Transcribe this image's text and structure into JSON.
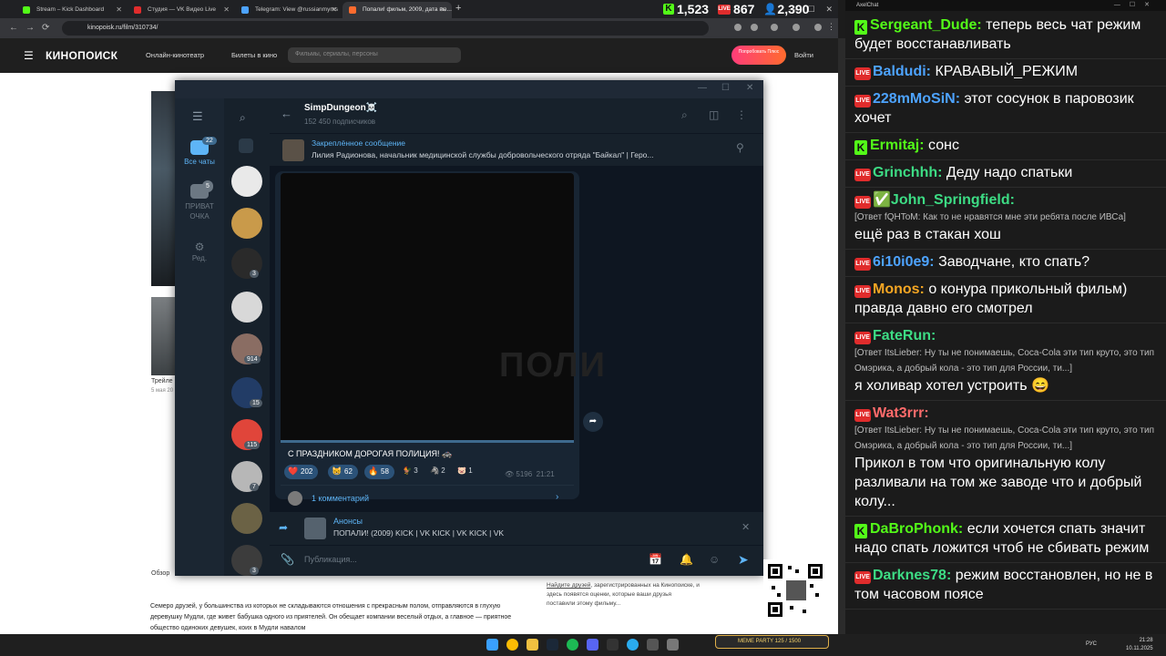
{
  "browser": {
    "tabs": [
      {
        "label": "Stream – Kick Dashboard",
        "color": "#53fc18"
      },
      {
        "label": "Студия — VK Видео Live",
        "color": "#e02c2c"
      },
      {
        "label": "Telegram: View @russianmyms",
        "color": "#4da3ff"
      },
      {
        "label": "Попали! фильм, 2009, дата вы...",
        "color": "#ff6b2e"
      }
    ],
    "new_tab": "+",
    "url": "kinopoisk.ru/film/310734/"
  },
  "stats": {
    "kick": "1,523",
    "vk": "867",
    "viewers": "2,390"
  },
  "kinopoisk": {
    "logo": "КИНОПОИСК",
    "nav": [
      "Онлайн-кинотеатр",
      "Билеты в кино"
    ],
    "search_placeholder": "Фильмы, сериалы, персоны",
    "promo": "Попробовать Плюс",
    "login": "Войти",
    "trailer": "Трейле",
    "date": "5 мая 20",
    "review": "Обзор",
    "description": "Семеро друзей, у большинства из которых не складываются отношения с прекрасным полом, отправляются в глухую деревушку Мудли, где живет бабушка одного из приятелей. Он обещает компании веселый отдых, а главное — приятное общество одиноких девушек, коих в Мудли навалом",
    "side_link": "Найдите друзей",
    "side_text": ", зарегистрированных на Кинопоиске, и здесь появятся оценки, которые ваши друзья поставили этому фильму..."
  },
  "telegram": {
    "folders": [
      {
        "label": "Все чаты",
        "badge": "22"
      },
      {
        "label": "ПРИВАТ ОЧКА",
        "badge": "5"
      },
      {
        "label": "Ред.",
        "badge": ""
      }
    ],
    "chat_badges": [
      "3",
      "914",
      "15",
      "115",
      "7",
      "3"
    ],
    "channel_name": "SimpDungeon☠️",
    "subscribers": "152 450 подписчиков",
    "pinned_title": "Закреплённое сообщение",
    "pinned_text": "Лилия Радионова, начальник медицинской службы добровольческого отряда \"Байкал\" | Геро...",
    "video_overlay": "ПОЛИ",
    "caption": "С ПРАЗДНИКОМ ДОРОГАЯ ПОЛИЦИЯ! 🚓",
    "reactions": [
      {
        "emoji": "❤️",
        "count": "202"
      },
      {
        "emoji": "😸",
        "count": "62"
      },
      {
        "emoji": "🔥",
        "count": "58"
      }
    ],
    "reactions_plain": [
      {
        "emoji": "🐓",
        "count": "3"
      },
      {
        "emoji": "🦓",
        "count": "2"
      },
      {
        "emoji": "🐷",
        "count": "1"
      }
    ],
    "views": "5196",
    "time": "21:21",
    "comments": "1 комментарий",
    "reply_title": "Анонсы",
    "reply_text": "ПОПАЛИ! (2009)  KICK | VK KICK | VK KICK | VK",
    "input_placeholder": "Публикация..."
  },
  "chat": {
    "title": "AxelChat",
    "messages": [
      {
        "platform": "kick",
        "name": "Sergeant_Dude:",
        "color": "#53fc18",
        "text": "теперь весь чат режим будет восстанавливать"
      },
      {
        "platform": "vk",
        "name": "Baldudi:",
        "color": "#4da3ff",
        "text": "КРАВАВЫЙ_РЕЖИМ"
      },
      {
        "platform": "vk",
        "name": "228mMoSiN:",
        "color": "#4da3ff",
        "text": "этот сосунок в паровозик хочет"
      },
      {
        "platform": "kick",
        "name": "Ermitaj:",
        "color": "#53fc18",
        "text": "сонс"
      },
      {
        "platform": "vk",
        "name": "Grinchhh:",
        "color": "#3ddc84",
        "text": "Деду надо спатьки"
      },
      {
        "platform": "vk",
        "name": "✅John_Springfield:",
        "color": "#3ddc84",
        "reply": "[Ответ fQHToM: Как то не нравятся мне эти ребята после ИВСа]",
        "text": "ещё раз в стакан хош"
      },
      {
        "platform": "vk",
        "name": "6i10i0e9:",
        "color": "#4da3ff",
        "text": "Заводчане, кто спать?"
      },
      {
        "platform": "vk",
        "name": "Monos:",
        "color": "#f5a623",
        "text": "о конура прикольный фильм) правда давно его смотрел"
      },
      {
        "platform": "vk",
        "name": "FateRun:",
        "color": "#3ddc84",
        "reply": "[Ответ ItsLieber: Ну ты не понимаешь, Coca-Cola эти тип круто, это тип Омэрика, а добрый кола - это тип для России, ти...]",
        "text": "я холивар хотел устроить 😄"
      },
      {
        "platform": "vk",
        "name": "Wat3rrr:",
        "color": "#ff6b6b",
        "reply": "[Ответ ItsLieber: Ну ты не понимаешь, Coca-Cola эти тип круто, это тип Омэрика, а добрый кола - это тип для России, ти...]",
        "text": "Прикол в том что оригинальную колу разливали на том же заводе что и добрый колу..."
      },
      {
        "platform": "kick",
        "name": "DaBroPhonk:",
        "color": "#53fc18",
        "text": "если хочется спать значит надо спать ложится чтоб не сбивать режим"
      },
      {
        "platform": "vk",
        "name": "Darknes78:",
        "color": "#3ddc84",
        "text": "режим восстановлен, но не в том часовом поясе"
      }
    ]
  },
  "taskbar": {
    "lang": "РУС",
    "time": "21:28",
    "date": "10.11.2025",
    "meme": "MEME PARTY  125 / 1500"
  }
}
